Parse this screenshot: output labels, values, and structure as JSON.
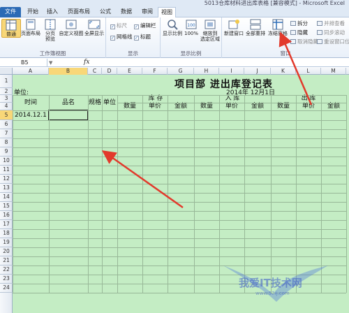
{
  "window": {
    "title": "5013仓库材料进出库表格 [兼容模式] - Microsoft Excel"
  },
  "tabs": [
    "文件",
    "开始",
    "插入",
    "页面布局",
    "公式",
    "数据",
    "审阅",
    "视图"
  ],
  "active_tab": "视图",
  "ribbon": {
    "workbook_views": {
      "label": "工作簿视图",
      "normal": "普通",
      "page_layout": "页面布局",
      "page_break_preview": "分页\n预览",
      "custom_views": "自定义视图",
      "full_screen": "全屏显示"
    },
    "show": {
      "label": "显示",
      "ruler": "标尺",
      "formula_bar": "编辑栏",
      "gridlines": "网格线",
      "headings": "标题"
    },
    "zoom": {
      "label": "显示比例",
      "zoom": "显示比例",
      "hundred": "100%",
      "zoom_to_selection": "缩放到\n选定区域"
    },
    "window": {
      "label": "窗口",
      "new_window": "新建窗口",
      "arrange_all": "全部重排",
      "freeze_panes": "冻结窗格",
      "split": "拆分",
      "hide": "隐藏",
      "unhide": "取消隐藏",
      "side_by_side": "并排查看",
      "sync_scroll": "同步滚动",
      "reset_position": "重设窗口位置"
    }
  },
  "formula_bar": {
    "name_box": "B5",
    "fx": "fx",
    "value": ""
  },
  "columns": [
    "A",
    "B",
    "C",
    "D",
    "E",
    "F",
    "G",
    "H",
    "I",
    "J",
    "K",
    "L",
    "M"
  ],
  "rows": [
    "1",
    "2",
    "3",
    "4",
    "5",
    "6",
    "7",
    "8",
    "9",
    "10",
    "11",
    "12",
    "13",
    "14",
    "15",
    "16",
    "17",
    "18",
    "19",
    "20",
    "21",
    "22",
    "23",
    "24"
  ],
  "active_row": "5",
  "sheet": {
    "title": "项目部  进出库登记表",
    "unit_label": "单位:",
    "date": "2014年  12月1日",
    "headers": {
      "time": "时间",
      "name": "品名",
      "spec": "规格",
      "unit": "单位",
      "stock": "库  存",
      "in": "入  库",
      "out": "出  库",
      "qty": "数量",
      "price": "单价",
      "amount": "金额"
    },
    "first_date": "2014.12.1"
  },
  "watermark": {
    "text": "我爱IT技术网",
    "url": "www.52ij.com"
  },
  "colors": {
    "accent": "#2b6ab5",
    "sheet_bg": "#c4edc4",
    "annotation": "#e23a2c"
  }
}
